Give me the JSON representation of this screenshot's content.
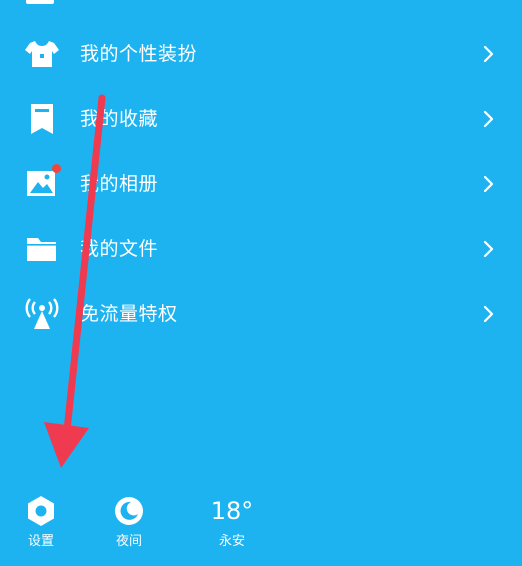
{
  "menu": {
    "items": [
      {
        "label": "我的个性装扮",
        "icon": "shirt-icon"
      },
      {
        "label": "我的收藏",
        "icon": "bookmark-icon"
      },
      {
        "label": "我的相册",
        "icon": "photo-album-icon"
      },
      {
        "label": "我的文件",
        "icon": "folder-icon"
      },
      {
        "label": "免流量特权",
        "icon": "signal-tower-icon"
      }
    ]
  },
  "bottom": {
    "settings_label": "设置",
    "night_label": "夜间",
    "temperature": "18°",
    "city": "永安"
  },
  "colors": {
    "background": "#1DB3F1",
    "text": "#FFFFFF",
    "badge": "#F2453D",
    "annotation_arrow": "#F03A50"
  }
}
